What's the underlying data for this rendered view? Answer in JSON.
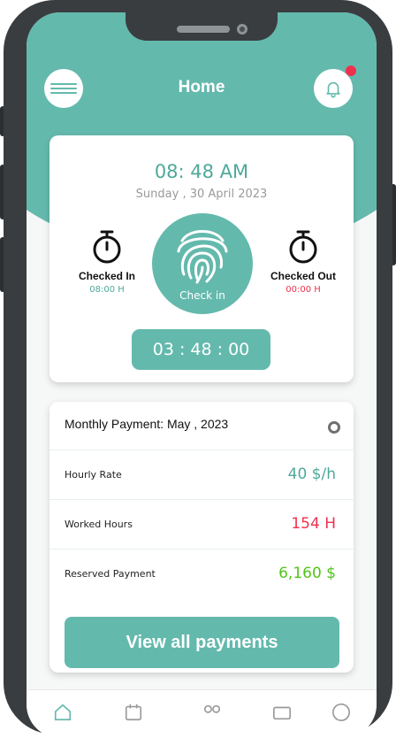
{
  "header": {
    "title": "Home"
  },
  "clock": {
    "time": "08: 48 AM",
    "date": "Sunday , 30 April 2023"
  },
  "checked_in": {
    "label": "Checked In",
    "value": "08:00 H"
  },
  "checked_out": {
    "label": "Checked Out",
    "value": "00:00 H"
  },
  "checkin_button": {
    "label": "Check in"
  },
  "duration": "03 : 48 : 00",
  "payment": {
    "title": "Monthly Payment: May , 2023",
    "rows": [
      {
        "label": "Hourly Rate",
        "value": "40 $/h",
        "color": "#4fa89b"
      },
      {
        "label": "Worked Hours",
        "value": "154 H",
        "color": "#f0314e"
      },
      {
        "label": "Reserved Payment",
        "value": "6,160 $",
        "color": "#52c41a"
      }
    ],
    "button_label": "View all payments"
  },
  "colors": {
    "accent": "#64b9ad",
    "alert": "#f0314e",
    "success": "#52c41a"
  },
  "icons": {
    "menu": "menu-icon",
    "bell": "bell-icon",
    "timer": "stopwatch-icon",
    "fingerprint": "fingerprint-icon",
    "nav": [
      "home-icon",
      "calendar-icon",
      "people-icon",
      "wallet-icon",
      "profile-icon"
    ]
  }
}
